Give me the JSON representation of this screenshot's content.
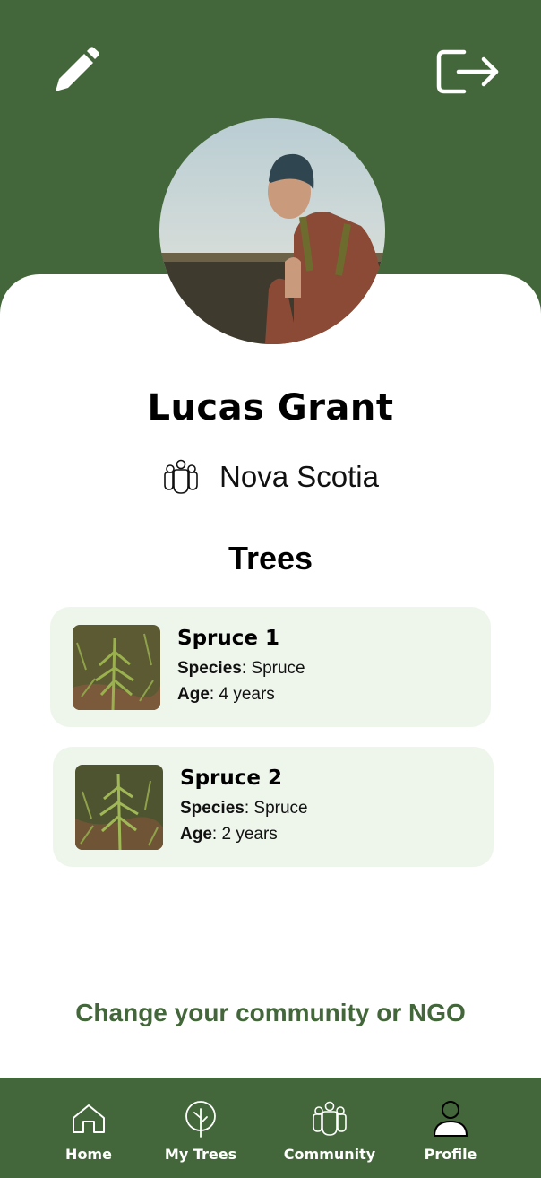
{
  "profile": {
    "name": "Lucas Grant",
    "location": "Nova Scotia"
  },
  "trees_section": {
    "heading": "Trees",
    "items": [
      {
        "name": "Spruce 1",
        "species_label": "Species",
        "species": "Spruce",
        "age_label": "Age",
        "age": "4 years"
      },
      {
        "name": "Spruce 2",
        "species_label": "Species",
        "species": "Spruce",
        "age_label": "Age",
        "age": "2 years"
      }
    ]
  },
  "change_link": "Change your community or NGO",
  "nav": {
    "home": "Home",
    "my_trees": "My Trees",
    "community": "Community",
    "profile": "Profile"
  },
  "icons": {
    "edit": "pencil-icon",
    "logout": "logout-icon",
    "location": "community-icon",
    "home": "home-icon",
    "my_trees": "tree-icon",
    "community": "community-icon",
    "profile": "person-icon"
  },
  "colors": {
    "brand_green": "#43673a",
    "card_background": "#eef6ec",
    "text": "#000000"
  }
}
